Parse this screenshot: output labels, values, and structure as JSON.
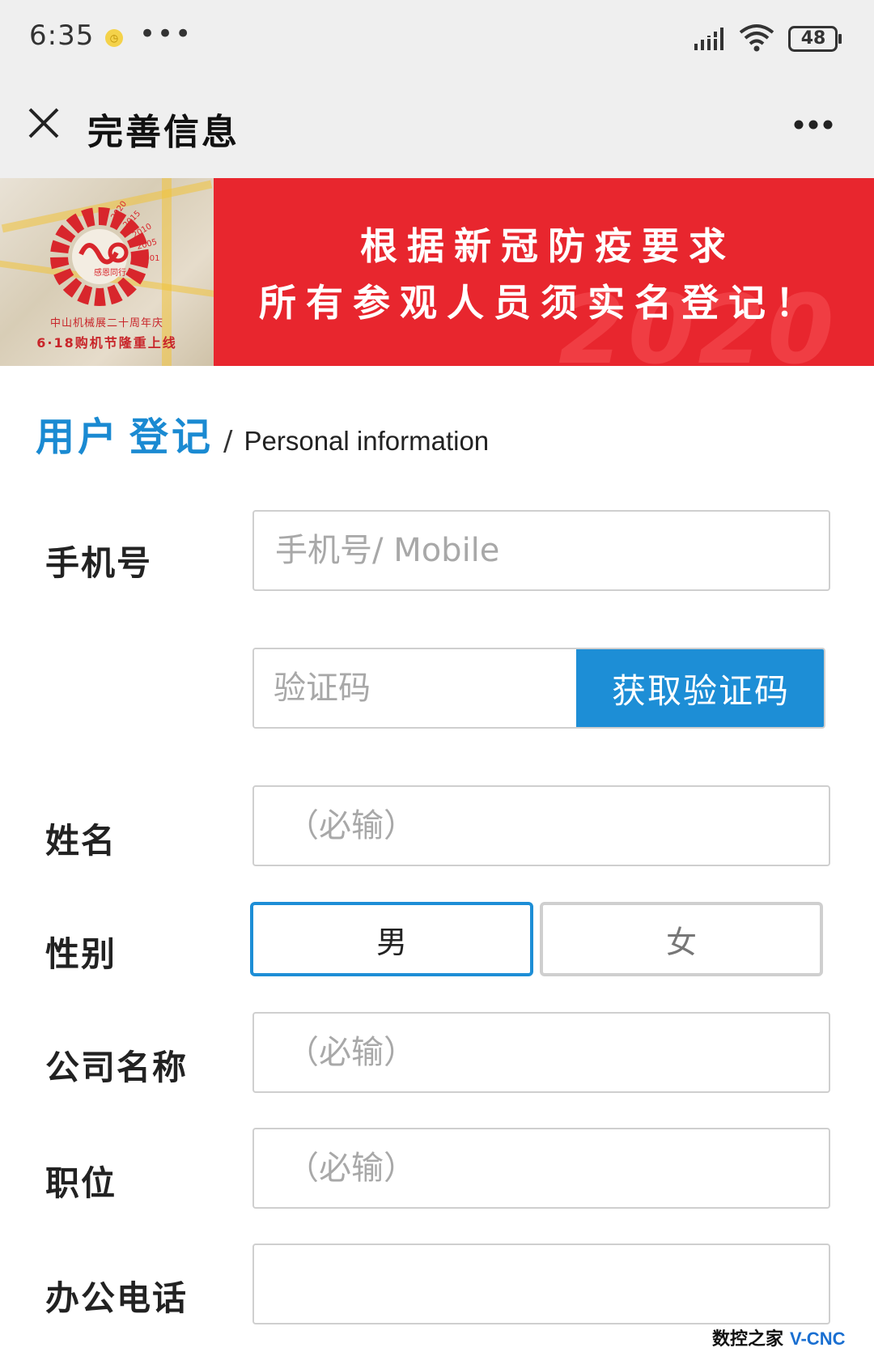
{
  "status_bar": {
    "time": "6:35",
    "dots": "•••",
    "battery": "48",
    "icons": [
      "app-notification-icon",
      "signal-icon",
      "wifi-icon",
      "battery-icon"
    ]
  },
  "nav": {
    "title": "完善信息",
    "close_icon": "close-icon",
    "more_icon": "more-icon"
  },
  "banner": {
    "line1": "根据新冠防疫要求",
    "line2": "所有参观人员须实名登记！",
    "watermark": "2020",
    "logo_caption_1": "中山机械展二十周年庆",
    "logo_caption_2": "6·18购机节隆重上线",
    "logo_years": [
      "2020",
      "2015",
      "2010",
      "2005",
      "2001"
    ],
    "logo_motto": "感恩同行",
    "accent_color": "#e8262e"
  },
  "section": {
    "title_cn_1": "用户",
    "title_cn_2": "登记",
    "separator": "/",
    "title_en": "Personal information",
    "title_color": "#1a8ad2"
  },
  "form": {
    "mobile": {
      "label": "手机号",
      "placeholder": "手机号/ Mobile",
      "value": ""
    },
    "code": {
      "placeholder": "验证码",
      "value": "",
      "button": "获取验证码"
    },
    "name": {
      "label": "姓名",
      "placeholder": "（必输）",
      "value": ""
    },
    "gender": {
      "label": "性别",
      "male": "男",
      "female": "女",
      "selected": "男"
    },
    "company": {
      "label": "公司名称",
      "placeholder": "（必输）",
      "value": ""
    },
    "position": {
      "label": "职位",
      "placeholder": "（必输）",
      "value": ""
    },
    "office_phone": {
      "label": "办公电话",
      "placeholder": "",
      "value": ""
    },
    "button_color": "#1d8ed6"
  },
  "watermark": {
    "cn": "数控之家",
    "en": "V-CNC"
  }
}
